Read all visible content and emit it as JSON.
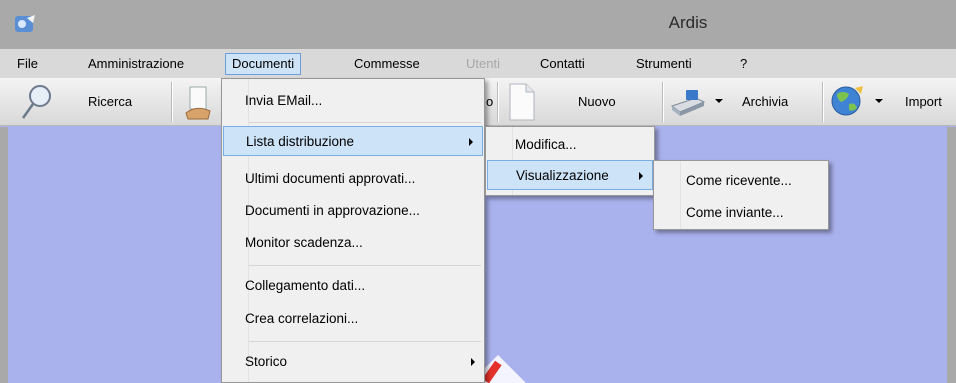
{
  "window": {
    "title": "Ardis"
  },
  "menubar": {
    "items": [
      {
        "label": "File"
      },
      {
        "label": "Amministrazione"
      },
      {
        "label": "Documenti"
      },
      {
        "label": "Commesse"
      },
      {
        "label": "Utenti"
      },
      {
        "label": "Contatti"
      },
      {
        "label": "Strumenti"
      },
      {
        "label": "?"
      }
    ]
  },
  "toolbar": {
    "ricerca": "Ricerca",
    "partial": "o",
    "nuovo": "Nuovo",
    "archivia": "Archivia",
    "importa": "Import"
  },
  "documenti_menu": {
    "items": [
      {
        "label": "Invia EMail..."
      },
      {
        "label": "Lista distribuzione"
      },
      {
        "label": "Ultimi documenti approvati..."
      },
      {
        "label": "Documenti in approvazione..."
      },
      {
        "label": "Monitor scadenza..."
      },
      {
        "label": "Collegamento dati..."
      },
      {
        "label": "Crea correlazioni..."
      },
      {
        "label": "Storico"
      }
    ]
  },
  "lista_menu": {
    "items": [
      {
        "label": "Modifica..."
      },
      {
        "label": "Visualizzazione"
      }
    ]
  },
  "visualizzazione_menu": {
    "items": [
      {
        "label": "Come ricevente..."
      },
      {
        "label": "Come inviante..."
      }
    ]
  },
  "colors": {
    "accent": "#cde3f8",
    "client": "#aab2ee",
    "titlebar": "#a9a9a9"
  }
}
